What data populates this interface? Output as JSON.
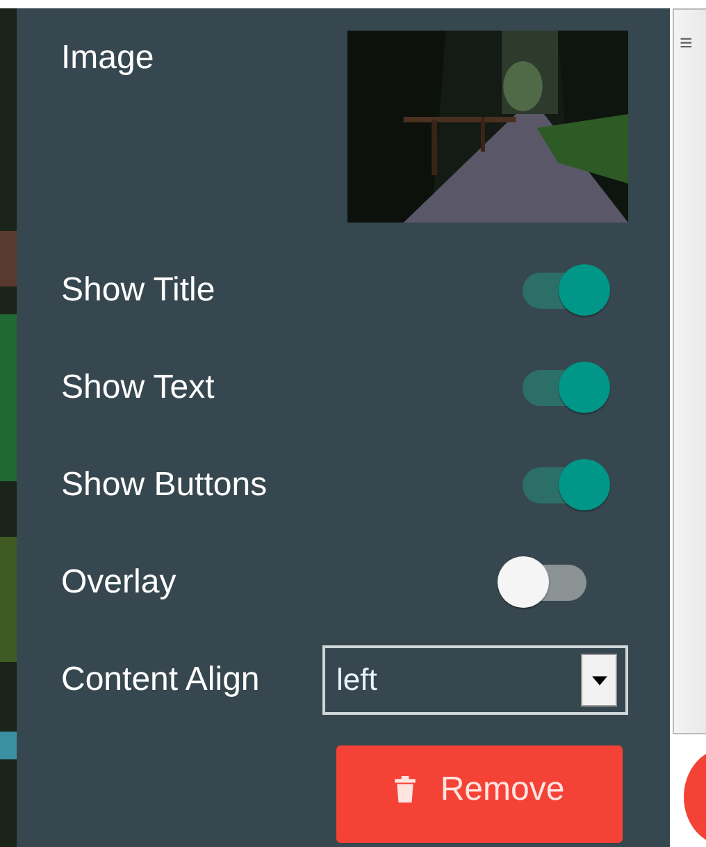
{
  "image_field": {
    "label": "Image",
    "kind": "picture"
  },
  "toggles": [
    {
      "label": "Show Title",
      "on": true
    },
    {
      "label": "Show Text",
      "on": true
    },
    {
      "label": "Show Buttons",
      "on": true
    },
    {
      "label": "Overlay",
      "on": false
    }
  ],
  "content_align": {
    "label": "Content Align",
    "value": "left"
  },
  "remove_button": {
    "label": "Remove"
  },
  "scroll_handle": {
    "glyph": "≡"
  }
}
